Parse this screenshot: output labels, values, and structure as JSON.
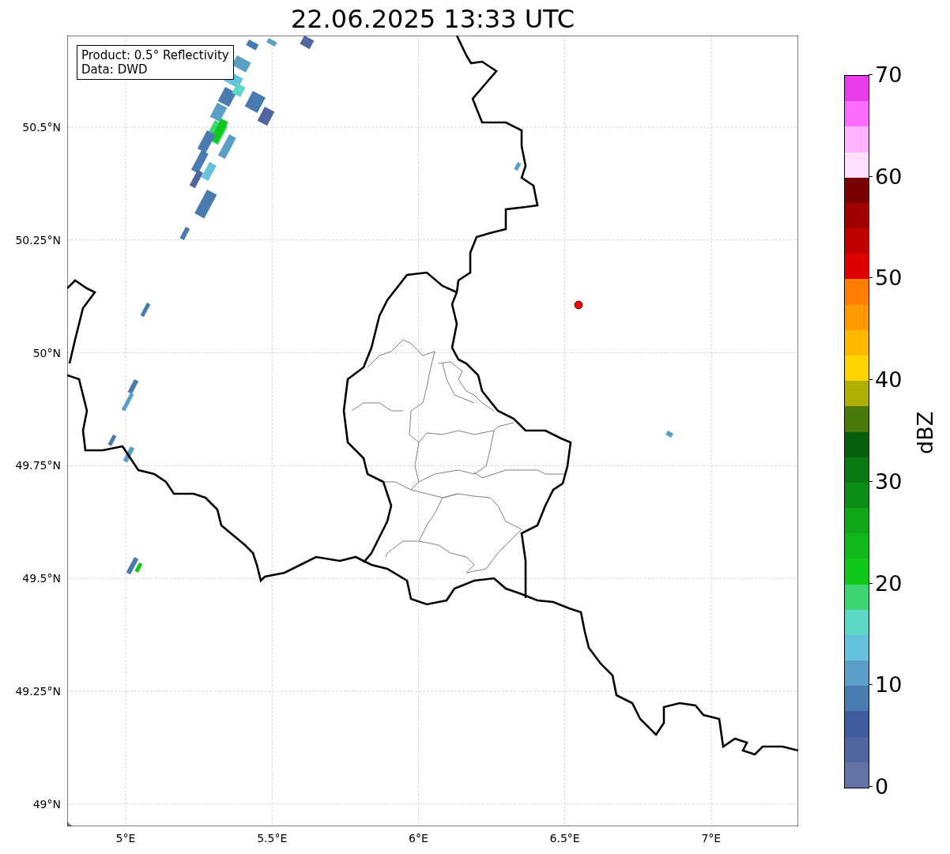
{
  "title": "22.06.2025 13:33 UTC",
  "info_box": {
    "lines": [
      "Product: 0.5° Reflectivity",
      "Data: DWD"
    ]
  },
  "map": {
    "y_ticks": [
      "50.5°N",
      "50.25°N",
      "50°N",
      "49.75°N",
      "49.5°N",
      "49.25°N",
      "49°N"
    ],
    "x_ticks": [
      "5°E",
      "5.5°E",
      "6°E",
      "6.5°E",
      "7°E"
    ]
  },
  "colorbar": {
    "label": "dBZ",
    "ticks": [
      "70",
      "60",
      "50",
      "40",
      "30",
      "20",
      "10",
      "0"
    ],
    "bins": [
      {
        "color": "#e83ce8"
      },
      {
        "color": "#ff6cff"
      },
      {
        "color": "#ffb4ff"
      },
      {
        "color": "#ffe0ff"
      },
      {
        "color": "#780000"
      },
      {
        "color": "#a00000"
      },
      {
        "color": "#c00000"
      },
      {
        "color": "#e00000"
      },
      {
        "color": "#ff7d00"
      },
      {
        "color": "#ff9a00"
      },
      {
        "color": "#ffb900"
      },
      {
        "color": "#ffd600"
      },
      {
        "color": "#b0b005"
      },
      {
        "color": "#4a7a0b"
      },
      {
        "color": "#075e0d"
      },
      {
        "color": "#0b7912"
      },
      {
        "color": "#0c8d15"
      },
      {
        "color": "#0fa718"
      },
      {
        "color": "#10b81c"
      },
      {
        "color": "#10c81a"
      },
      {
        "color": "#3dd673"
      },
      {
        "color": "#5ed8c4"
      },
      {
        "color": "#64c2dc"
      },
      {
        "color": "#5b9fc6"
      },
      {
        "color": "#4a7bb0"
      },
      {
        "color": "#415b9f"
      },
      {
        "color": "#51669f"
      },
      {
        "color": "#6473a6"
      }
    ]
  }
}
